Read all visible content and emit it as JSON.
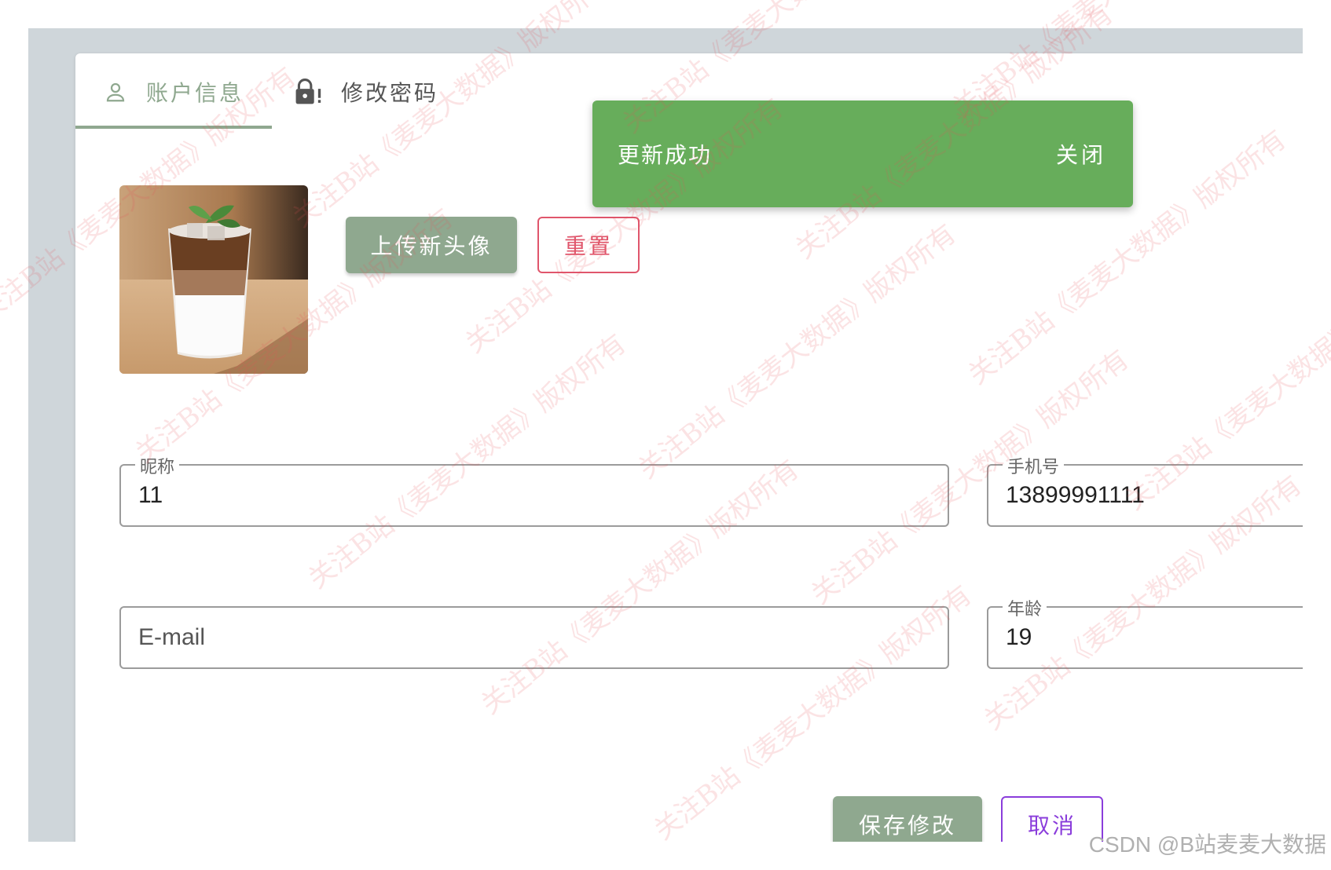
{
  "tabs": {
    "account_label": "账户信息",
    "password_label": "修改密码"
  },
  "snackbar": {
    "message": "更新成功",
    "close_label": "关闭"
  },
  "avatar": {
    "upload_label": "上传新头像",
    "reset_label": "重置"
  },
  "form": {
    "nickname": {
      "label": "昵称",
      "value": "11"
    },
    "phone": {
      "label": "手机号",
      "value": "13899991111"
    },
    "email": {
      "placeholder": "E-mail",
      "value": ""
    },
    "age": {
      "label": "年龄",
      "value": "19"
    }
  },
  "actions": {
    "save_label": "保存修改",
    "cancel_label": "取消"
  },
  "watermark_text": "关注B站《麦麦大数据》版权所有",
  "credit": "CSDN @B站麦麦大数据",
  "colors": {
    "primary": "#8fa88f",
    "success": "#67ad5b",
    "danger": "#e0566c",
    "purple": "#8a3ddb"
  }
}
